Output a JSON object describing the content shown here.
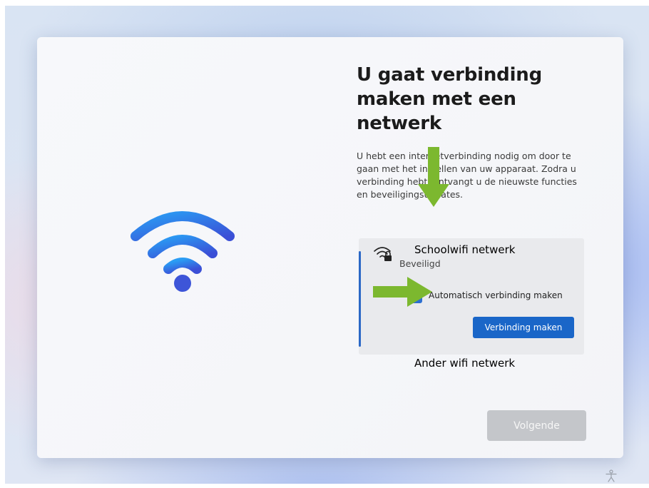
{
  "dialog": {
    "title": "U gaat verbinding maken met een netwerk",
    "description": "U hebt een internetverbinding nodig om door te gaan met het instellen van uw apparaat. Zodra u verbinding hebt, ontvangt u de nieuwste functies en beveiligingsupdates.",
    "hero_icon": "wifi-icon"
  },
  "network": {
    "name": "Schoolwifi netwerk",
    "status": "Beveiligd",
    "icon": "wifi-lock-icon",
    "auto_connect_label": "Automatisch verbinding maken",
    "auto_connect_checked": true,
    "connect_label": "Verbinding maken"
  },
  "other_network_label": "Ander wifi netwerk",
  "next_label": "Volgende",
  "colors": {
    "accent": "#1a66c8",
    "annotation_arrow": "#7cb82f",
    "disabled_button": "#c4c6ca"
  }
}
